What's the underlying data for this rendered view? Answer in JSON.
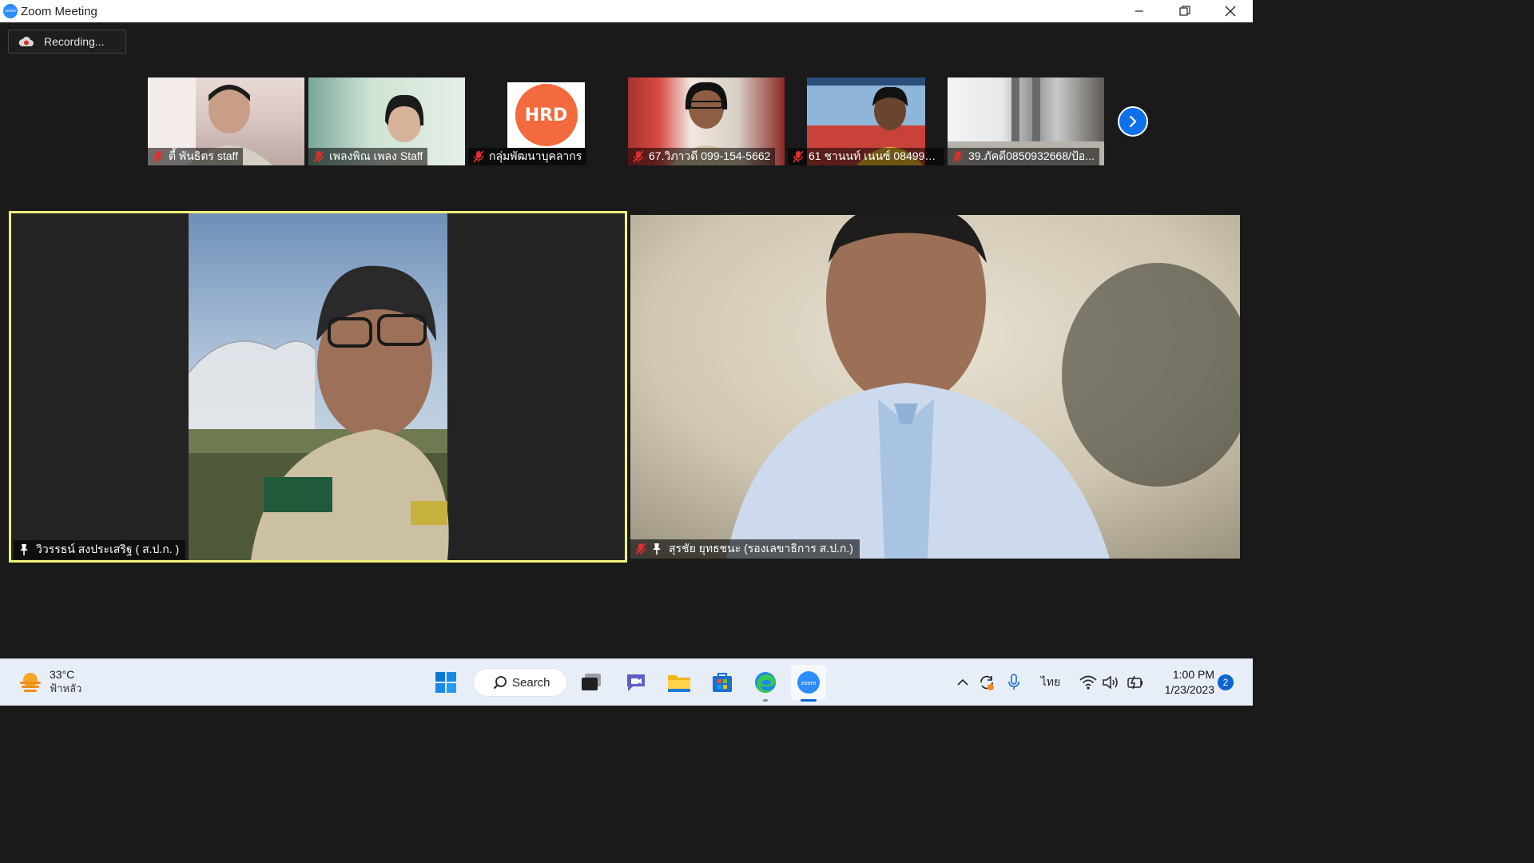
{
  "window": {
    "title": "Zoom Meeting",
    "logo_text": "zoom"
  },
  "recording": {
    "label": "Recording..."
  },
  "gallery_strip": [
    {
      "name": "ตี้ พันธิตร staff"
    },
    {
      "name": "เพลงพิณ เพลง Staff"
    },
    {
      "name": "กลุ่มพัฒนาบุคลากร",
      "logo_text": "HRD"
    },
    {
      "name": "67.วิภาวดี 099-154-5662"
    },
    {
      "name": "61 ชานนท์ เนนซ์ 084999..."
    },
    {
      "name": "39.ภัคดี0850932668/ป้อ..."
    }
  ],
  "speakers": [
    {
      "name": "วิวรรธน์ สงประเสริฐ ( ส.ป.ก. )",
      "active": true,
      "pinned": true
    },
    {
      "name": "สุรชัย ยุทธชนะ (รองเลขาธิการ ส.ป.ก.)",
      "muted": true,
      "pinned": true
    }
  ],
  "colors": {
    "active_speaker_border": "#f0ef7a",
    "zoom_blue": "#0e71eb",
    "muted_red": "#e02f2f"
  },
  "taskbar": {
    "weather": {
      "temp": "33°C",
      "condition": "ฟ้าหลัว"
    },
    "search_label": "Search",
    "language": "ไทย",
    "time": "1:00 PM",
    "date": "1/23/2023",
    "notification_count": "2",
    "apps": [
      "windows-start-icon",
      "task-view-icon",
      "teams-chat-icon",
      "file-explorer-icon",
      "microsoft-store-icon",
      "edge-icon",
      "zoom-icon"
    ]
  }
}
